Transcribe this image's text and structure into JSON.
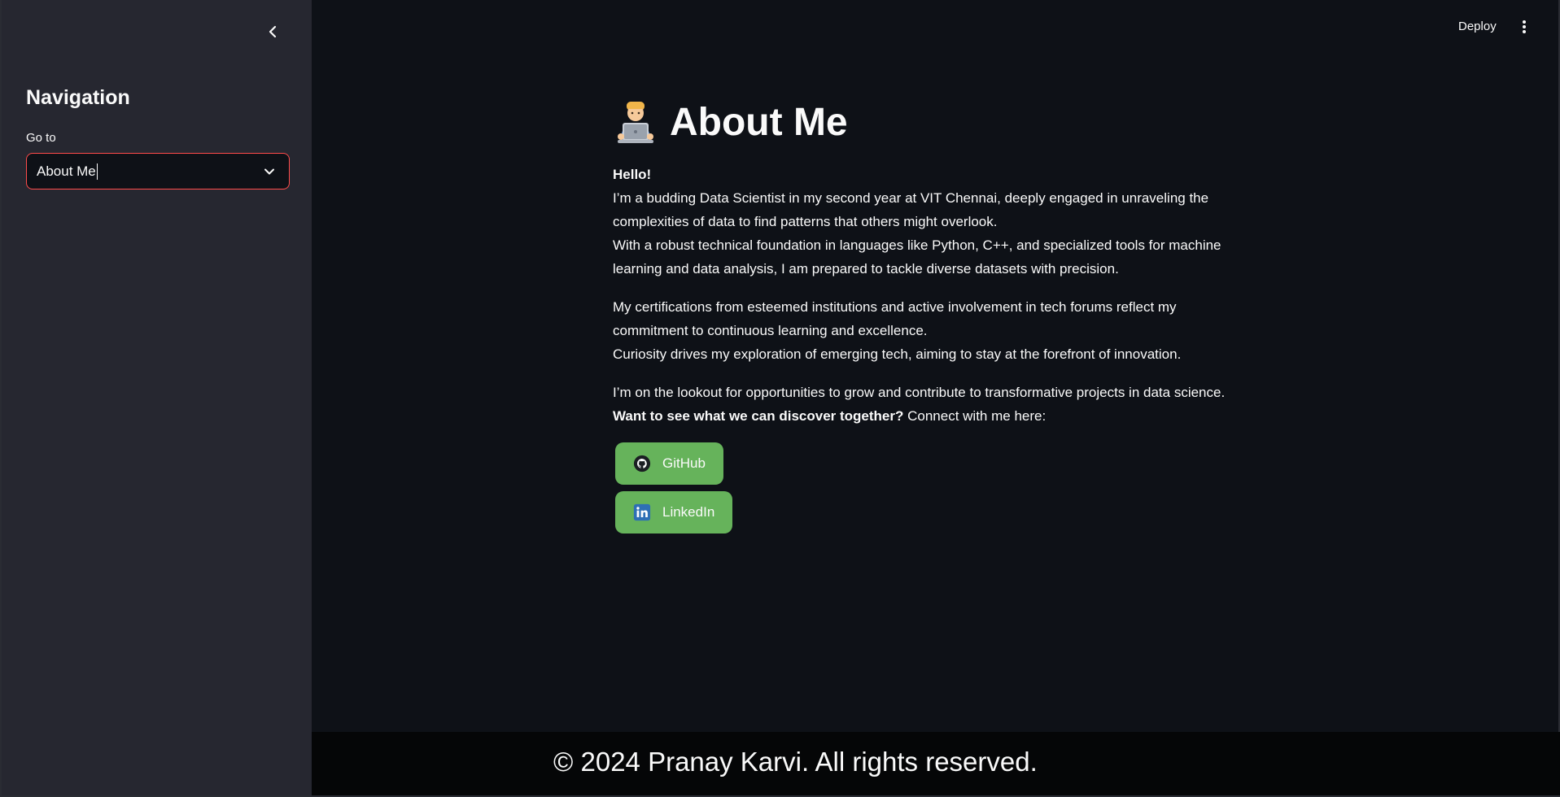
{
  "sidebar": {
    "title": "Navigation",
    "select_label": "Go to",
    "select_value": "About Me"
  },
  "header": {
    "deploy_label": "Deploy"
  },
  "main": {
    "title": "About Me",
    "greeting": "Hello!",
    "intro_line1": "I’m a budding Data Scientist in my second year at VIT Chennai, deeply engaged in unraveling the",
    "intro_line2": "complexities of data to find patterns that others might overlook.",
    "intro_line3": "With a robust technical foundation in languages like Python, C++, and specialized tools for machine",
    "intro_line4": "learning and data analysis, I am prepared to tackle diverse datasets with precision.",
    "cert_line1": "My certifications from esteemed institutions and active involvement in tech forums reflect my",
    "cert_line2": "commitment to continuous learning and excellence.",
    "cert_line3": "Curiosity drives my exploration of emerging tech, aiming to stay at the forefront of innovation.",
    "lookout_line": "I’m on the lookout for opportunities to grow and contribute to transformative projects in data science.",
    "cta_bold": "Want to see what we can discover together?",
    "cta_rest": " Connect with me here:",
    "buttons": [
      {
        "label": "GitHub",
        "icon": "github-icon"
      },
      {
        "label": "LinkedIn",
        "icon": "linkedin-icon"
      }
    ],
    "button_color": "#66b35b"
  },
  "footer": {
    "text": "© 2024 Pranay Karvi. All rights reserved."
  },
  "colors": {
    "background": "#0e1117",
    "sidebar": "#262730",
    "accent": "#ff4b4b",
    "footer": "#050607"
  }
}
